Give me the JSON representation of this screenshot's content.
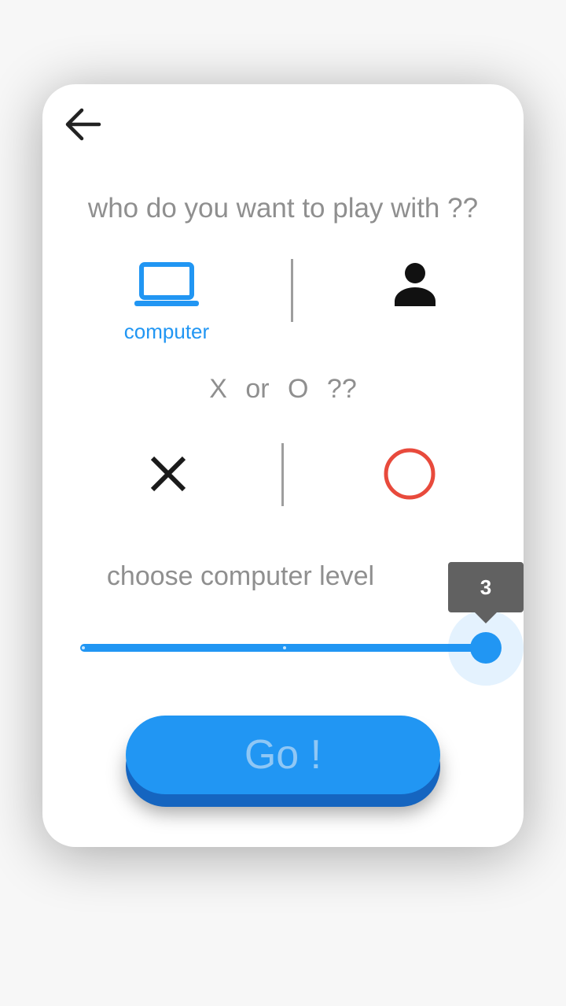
{
  "header": {
    "back_icon": "arrow-left-icon"
  },
  "opponent": {
    "question": "who do you want to play with ??",
    "options": [
      {
        "label": "computer",
        "icon": "laptop-icon",
        "selected": true
      },
      {
        "label": "",
        "icon": "person-icon",
        "selected": false
      }
    ]
  },
  "symbol": {
    "question": "X   or   O   ??",
    "options": [
      {
        "icon": "x-icon",
        "color": "#1a1a1a"
      },
      {
        "icon": "circle-icon",
        "color": "#e84a3c"
      }
    ]
  },
  "level": {
    "label": "choose computer level",
    "min": 1,
    "max": 3,
    "value": 3,
    "value_label": "3"
  },
  "go_button": {
    "label": "Go !"
  },
  "colors": {
    "accent": "#2196f3",
    "accent_dark": "#1565c0",
    "text_muted": "#8f8f8f",
    "tooltip_bg": "#616161"
  }
}
